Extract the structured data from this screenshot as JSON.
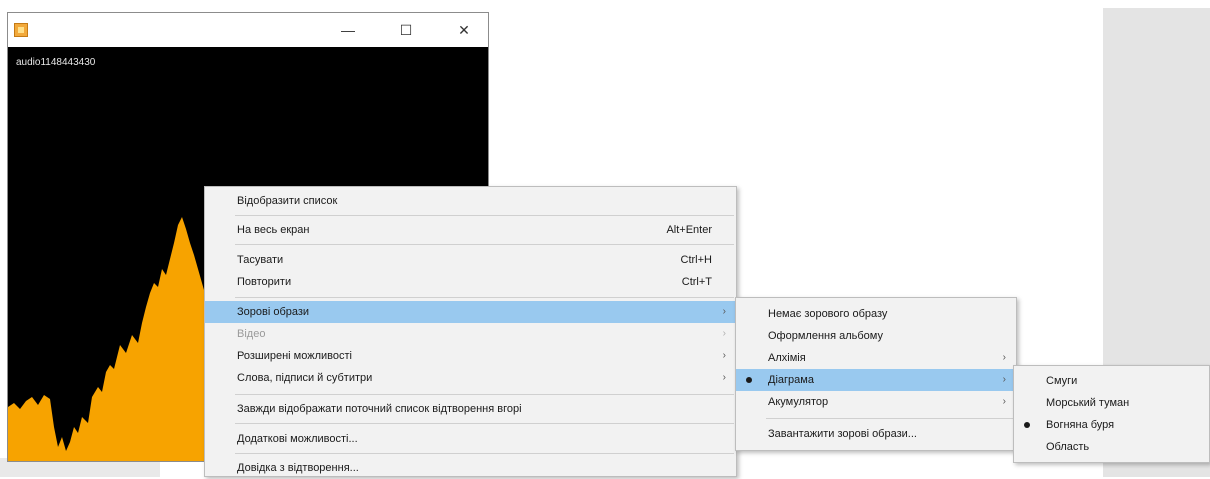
{
  "player": {
    "media_title": "audio1148443430",
    "icon": "app-icon",
    "controls": {
      "minimize": "—",
      "maximize": "☐",
      "close": "✕"
    },
    "visualization_color": "#f7a300"
  },
  "menu": {
    "items": [
      {
        "label": "Відобразити список"
      },
      {
        "label": "На весь екран",
        "accel": "Alt+Enter"
      },
      {
        "label": "Тасувати",
        "accel": "Ctrl+H"
      },
      {
        "label": "Повторити",
        "accel": "Ctrl+T"
      },
      {
        "label": "Зорові образи",
        "arrow": "›"
      },
      {
        "label": "Відео",
        "arrow": "›"
      },
      {
        "label": "Розширені можливості",
        "arrow": "›"
      },
      {
        "label": "Слова, підписи й субтитри",
        "arrow": "›"
      },
      {
        "label": "Завжди відображати поточний список відтворення вгорі"
      },
      {
        "label": "Додаткові можливості..."
      },
      {
        "label": "Довідка з відтворення..."
      }
    ]
  },
  "submenu_visualizations": {
    "items": [
      {
        "label": "Немає зорового образу"
      },
      {
        "label": "Оформлення альбому"
      },
      {
        "label": "Алхімія",
        "arrow": "›"
      },
      {
        "label": "Діаграма",
        "arrow": "›"
      },
      {
        "label": "Акумулятор",
        "arrow": "›"
      },
      {
        "label": "Завантажити зорові образи..."
      }
    ]
  },
  "submenu_bars": {
    "items": [
      {
        "label": "Смуги"
      },
      {
        "label": "Морський туман"
      },
      {
        "label": "Вогняна буря"
      },
      {
        "label": "Область"
      }
    ]
  },
  "colors": {
    "highlight": "#99c9ef",
    "menu_bg": "#f2f2f2"
  }
}
